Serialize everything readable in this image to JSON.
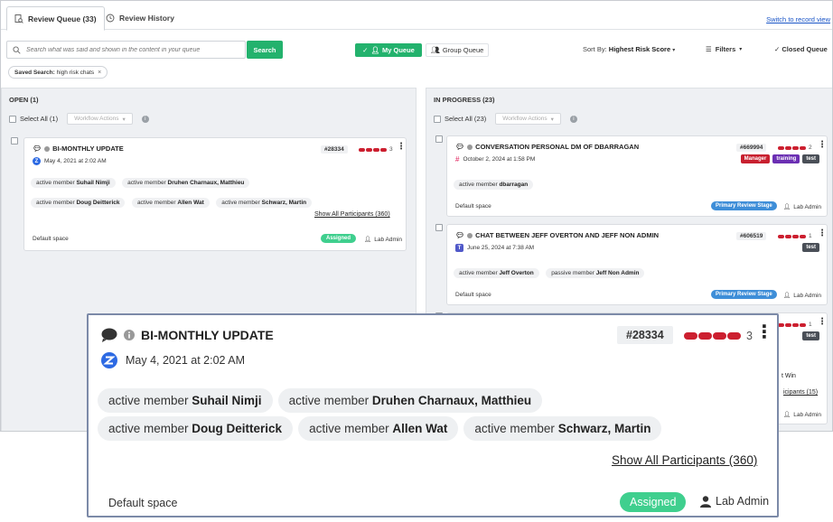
{
  "tabs": [
    {
      "label": "Review Queue (33)",
      "active": true
    },
    {
      "label": "Review History",
      "active": false
    }
  ],
  "switch_link": "Switch to record view",
  "search": {
    "placeholder": "Search what was said and shown in the content in your queue",
    "button": "Search"
  },
  "queue_toggle": {
    "my_queue": "My Queue",
    "group_queue": "Group Queue"
  },
  "sort": {
    "label": "Sort By:",
    "value": "Highest Risk Score"
  },
  "filters_label": "Filters",
  "closed_label": "Closed Queue",
  "saved_search": {
    "prefix": "Saved Search:",
    "value": "high risk chats"
  },
  "open_column": {
    "title": "OPEN (1)",
    "select_all": "Select All (1)",
    "workflow": "Workflow Actions",
    "cards": [
      {
        "title": "BI-MONTHLY UPDATE",
        "date": "May 4, 2021 at 2:02 AM",
        "id": "#28334",
        "risk": "3",
        "participants": [
          {
            "role": "active member",
            "name": "Suhail Nimji"
          },
          {
            "role": "active member",
            "name": "Druhen Charnaux, Matthieu"
          },
          {
            "role": "active member",
            "name": "Doug Deitterick"
          },
          {
            "role": "active member",
            "name": "Allen Wat"
          },
          {
            "role": "active member",
            "name": "Schwarz, Martin"
          }
        ],
        "show_all": "Show All Participants (360)",
        "space": "Default space",
        "status": "Assigned",
        "owner": "Lab Admin"
      }
    ]
  },
  "progress_column": {
    "title": "IN PROGRESS (23)",
    "select_all": "Select All (23)",
    "workflow": "Workflow Actions",
    "cards": [
      {
        "title": "CONVERSATION PERSONAL DM OF DBARRAGAN",
        "date": "October 2, 2024 at 1:58 PM",
        "id": "#669994",
        "risk": "2",
        "tags": [
          {
            "label": "Manager",
            "color": "#c8202f"
          },
          {
            "label": "training",
            "color": "#6b2fb3"
          },
          {
            "label": "test",
            "color": "#4a4f57"
          }
        ],
        "participants": [
          {
            "role": "active member",
            "name": "dbarragan"
          }
        ],
        "space": "Default space",
        "stage": "Primary Review Stage",
        "owner": "Lab Admin"
      },
      {
        "title": "CHAT BETWEEN JEFF OVERTON AND JEFF NON ADMIN",
        "date": "June 25, 2024 at 7:38 AM",
        "id": "#606519",
        "risk": "1",
        "tags": [
          {
            "label": "test",
            "color": "#4a4f57"
          }
        ],
        "participants": [
          {
            "role": "active member",
            "name": "Jeff Overton"
          },
          {
            "role": "passive member",
            "name": "Jeff Non Admin"
          }
        ],
        "space": "Default space",
        "stage": "Primary Review Stage",
        "owner": "Lab Admin"
      },
      {
        "risk": "1",
        "tags": [
          {
            "label": "test",
            "color": "#4a4f57"
          }
        ],
        "partial_title": "t Win",
        "partial_link": "icipants (15)",
        "owner": "Lab Admin"
      }
    ]
  }
}
